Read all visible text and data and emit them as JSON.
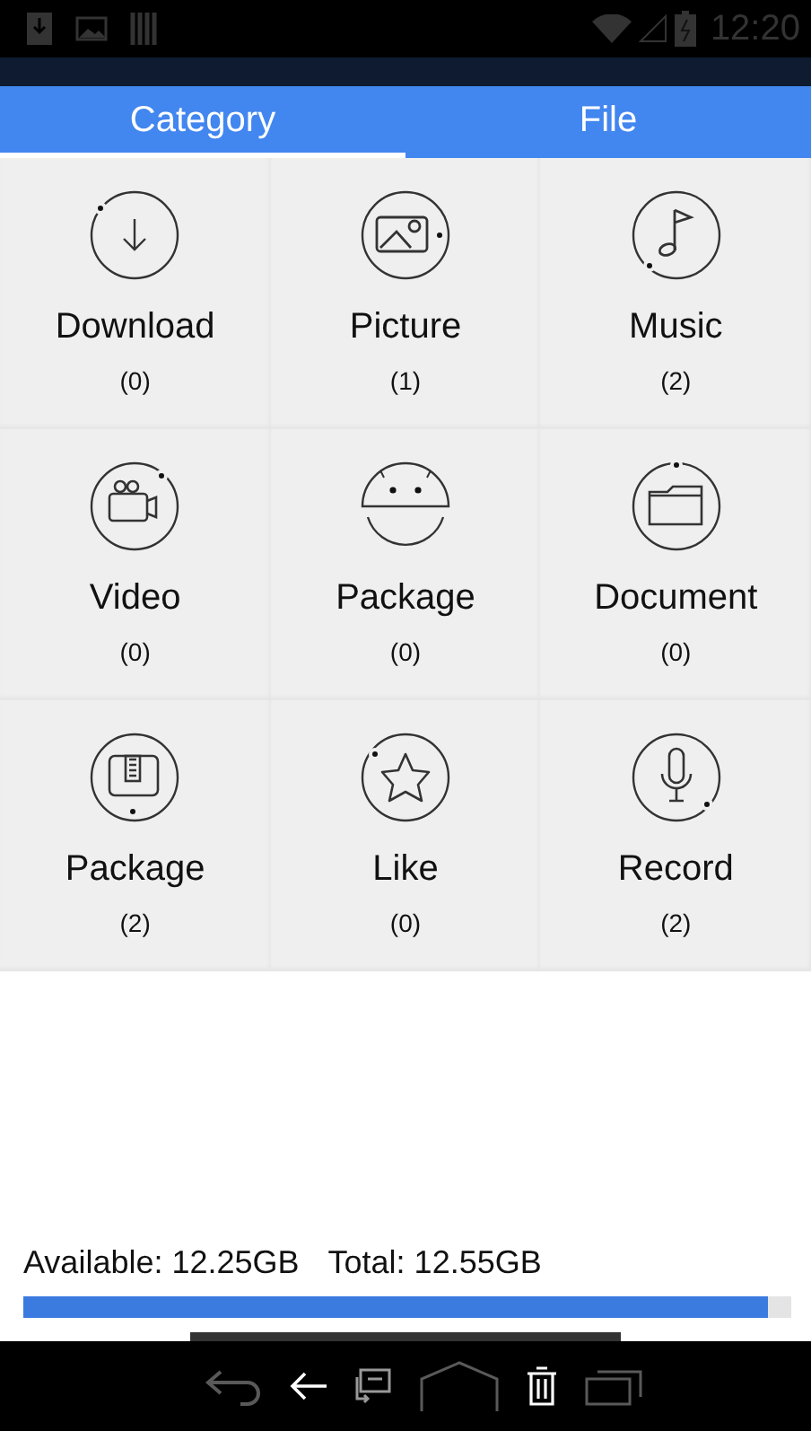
{
  "status_bar": {
    "time": "12:20"
  },
  "tabs": [
    {
      "label": "Category",
      "selected": true
    },
    {
      "label": "File",
      "selected": false
    }
  ],
  "categories": [
    {
      "kind": "download",
      "name": "Download",
      "count": "(0)"
    },
    {
      "kind": "picture",
      "name": "Picture",
      "count": "(1)"
    },
    {
      "kind": "music",
      "name": "Music",
      "count": "(2)"
    },
    {
      "kind": "video",
      "name": "Video",
      "count": "(0)"
    },
    {
      "kind": "apk",
      "name": "Package",
      "count": "(0)"
    },
    {
      "kind": "document",
      "name": "Document",
      "count": "(0)"
    },
    {
      "kind": "zip",
      "name": "Package",
      "count": "(2)"
    },
    {
      "kind": "like",
      "name": "Like",
      "count": "(0)"
    },
    {
      "kind": "record",
      "name": "Record",
      "count": "(2)"
    }
  ],
  "storage": {
    "available": "Available: 12.25GB",
    "total": "Total: 12.55GB",
    "level": 0.97
  }
}
